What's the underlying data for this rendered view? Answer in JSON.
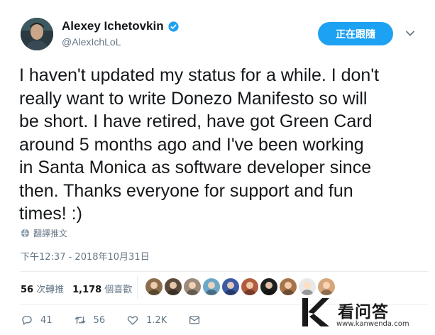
{
  "author": {
    "name": "Alexey Ichetovkin",
    "handle": "@AlexIchLoL",
    "verified": true
  },
  "follow_button": {
    "label": "正在跟隨"
  },
  "tweet": {
    "text": "I haven't updated my status for a while. I don't\nreally want to write Donezo Manifesto so will\nbe short. I have retired, have got Green Card\naround 5 months ago and I've been working\nin Santa Monica as software developer since\nthen. Thanks everyone for support and fun\ntimes! :)",
    "translate_label": "翻譯推文",
    "timestamp": "下午12:37 - 2018年10月31日"
  },
  "stats": {
    "retweets_count": "56",
    "retweets_label": "次轉推",
    "likes_count": "1,178",
    "likes_label": "個喜歡"
  },
  "likers": [
    {
      "color": "#8a6d4b"
    },
    {
      "color": "#5b4a3a"
    },
    {
      "color": "#9c8a7a"
    },
    {
      "color": "#6ea8c8"
    },
    {
      "color": "#3b5ba5"
    },
    {
      "color": "#b25d3f"
    },
    {
      "color": "#1f1f1f"
    },
    {
      "color": "#a8744a"
    },
    {
      "color": "#e8e8e8"
    },
    {
      "color": "#d6a67a"
    }
  ],
  "actions": {
    "reply_count": "41",
    "retweet_count": "56",
    "like_count": "1.2K"
  },
  "watermark": {
    "title": "看问答",
    "url": "www.kanwenda.com"
  },
  "colors": {
    "accent": "#1da1f2",
    "muted": "#657786",
    "text": "#14171a"
  }
}
